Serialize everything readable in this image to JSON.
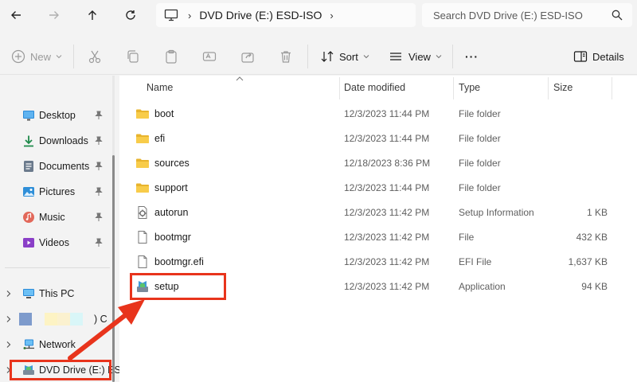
{
  "nav": {
    "back": "back-arrow-icon",
    "forward": "forward-arrow-icon",
    "up": "up-arrow-icon",
    "refresh": "refresh-icon"
  },
  "address": {
    "path": "DVD Drive (E:) ESD-ISO",
    "separator": "›"
  },
  "search": {
    "placeholder": "Search DVD Drive (E:) ESD-ISO"
  },
  "toolbar": {
    "new_label": "New",
    "sort_label": "Sort",
    "view_label": "View",
    "more_label": "···",
    "details_label": "Details"
  },
  "sidebar": {
    "pinned": [
      {
        "label": "Desktop",
        "icon": "desktop-icon"
      },
      {
        "label": "Downloads",
        "icon": "downloads-icon"
      },
      {
        "label": "Documents",
        "icon": "documents-icon"
      },
      {
        "label": "Pictures",
        "icon": "pictures-icon"
      },
      {
        "label": "Music",
        "icon": "music-icon"
      },
      {
        "label": "Videos",
        "icon": "videos-icon"
      }
    ],
    "tree": [
      {
        "label": "This PC",
        "icon": "this-pc-icon"
      },
      {
        "label": ") C",
        "icon": "blurred-drive-icon"
      },
      {
        "label": "Network",
        "icon": "network-icon"
      },
      {
        "label": "DVD Drive (E:) ES",
        "icon": "dvd-drive-icon"
      }
    ]
  },
  "columns": {
    "name": "Name",
    "date": "Date modified",
    "type": "Type",
    "size": "Size"
  },
  "files": [
    {
      "name": "boot",
      "date": "12/3/2023 11:44 PM",
      "type": "File folder",
      "size": "",
      "icon": "folder-icon"
    },
    {
      "name": "efi",
      "date": "12/3/2023 11:44 PM",
      "type": "File folder",
      "size": "",
      "icon": "folder-icon"
    },
    {
      "name": "sources",
      "date": "12/18/2023 8:36 PM",
      "type": "File folder",
      "size": "",
      "icon": "folder-icon"
    },
    {
      "name": "support",
      "date": "12/3/2023 11:44 PM",
      "type": "File folder",
      "size": "",
      "icon": "folder-icon"
    },
    {
      "name": "autorun",
      "date": "12/3/2023 11:42 PM",
      "type": "Setup Information",
      "size": "1 KB",
      "icon": "setup-info-icon"
    },
    {
      "name": "bootmgr",
      "date": "12/3/2023 11:42 PM",
      "type": "File",
      "size": "432 KB",
      "icon": "file-icon"
    },
    {
      "name": "bootmgr.efi",
      "date": "12/3/2023 11:42 PM",
      "type": "EFI File",
      "size": "1,637 KB",
      "icon": "file-icon"
    },
    {
      "name": "setup",
      "date": "12/3/2023 11:42 PM",
      "type": "Application",
      "size": "94 KB",
      "icon": "setup-app-icon"
    }
  ],
  "colors": {
    "highlight": "#e8341c",
    "folder": "#f4c542",
    "accent": "#0067c0"
  }
}
